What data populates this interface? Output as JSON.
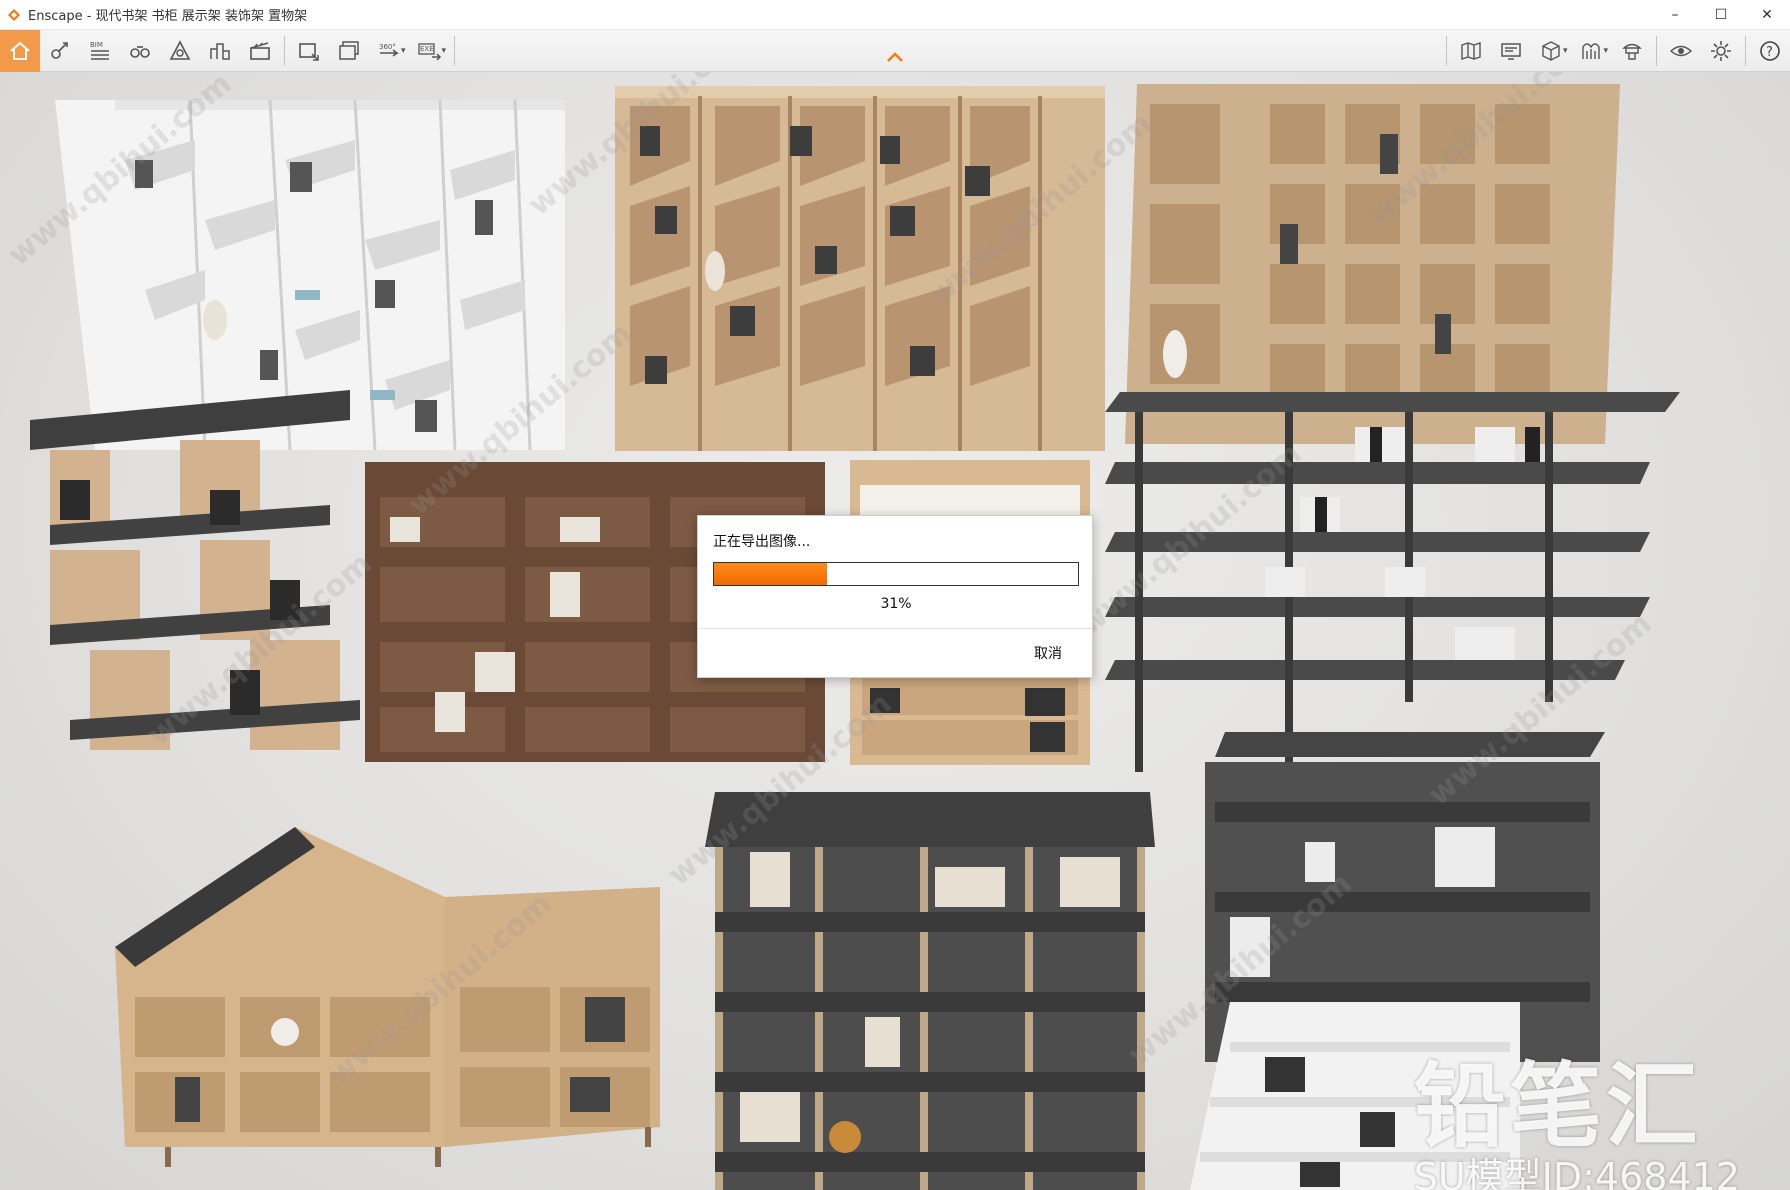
{
  "window": {
    "title": "Enscape - 现代书架 书柜 展示架 装饰架 置物架",
    "minimize": "–",
    "maximize": "☐",
    "close": "✕"
  },
  "toolbar": {
    "left_icons": [
      "home-icon",
      "asset-library-icon",
      "bim-icon",
      "binoculars-icon",
      "views-icon",
      "buildings-icon",
      "clapper-icon",
      "screenshot-icon",
      "batch-render-icon",
      "panorama-360-icon",
      "export-exe-icon"
    ],
    "right_icons": [
      "map-icon",
      "monitor-icon",
      "cube-icon",
      "material-icon",
      "chat-hat-icon",
      "eye-icon",
      "gear-icon",
      "help-icon"
    ]
  },
  "dialog": {
    "title": "正在导出图像...",
    "progress": 0.31,
    "progress_label": "31%",
    "cancel": "取消"
  },
  "watermark": {
    "brand": "铅笔汇",
    "model_id": "SU模型ID:468412",
    "url": "www.qbihui.com"
  },
  "colors": {
    "accent": "#f26a00",
    "home_button": "#f29a4a"
  }
}
